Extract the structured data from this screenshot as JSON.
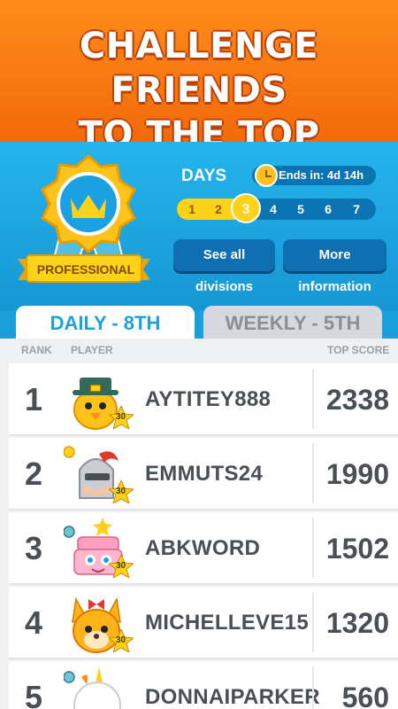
{
  "banner": {
    "line1": "CHALLENGE FRIENDS",
    "line2": "TO THE TOP"
  },
  "division": {
    "name": "PROFESSIONAL",
    "days_label": "DAYS",
    "ends_in": "Ends in: 4d 14h",
    "days": [
      "1",
      "2",
      "3",
      "4",
      "5",
      "6",
      "7"
    ],
    "current_day": 3,
    "see_all_label": "See all divisions",
    "more_info_label": "More information"
  },
  "tabs": {
    "daily": "DAILY - 8TH",
    "weekly": "WEEKLY - 5TH",
    "active": "daily"
  },
  "table": {
    "headers": {
      "rank": "RANK",
      "player": "PLAYER",
      "score": "TOP SCORE"
    },
    "rows": [
      {
        "rank": "1",
        "player": "AYTITEY888",
        "level": "30",
        "score": "2338",
        "avatar": "chick-pilgrim-avatar"
      },
      {
        "rank": "2",
        "player": "EMMUTS24",
        "level": "30",
        "score": "1990",
        "avatar": "knight-avatar"
      },
      {
        "rank": "3",
        "player": "ABKWORD",
        "level": "30",
        "score": "1502",
        "avatar": "cake-avatar"
      },
      {
        "rank": "4",
        "player": "MICHELLEVE15",
        "level": "30",
        "score": "1320",
        "avatar": "fox-bow-avatar"
      },
      {
        "rank": "5",
        "player": "DONNAIPARKER",
        "level": "",
        "score": "560",
        "avatar": "unicorn-avatar"
      }
    ]
  },
  "colors": {
    "orange": "#f26a0a",
    "blue": "#1a9fd9",
    "gold": "#ffd21a",
    "text_dark": "#4a4f55"
  }
}
